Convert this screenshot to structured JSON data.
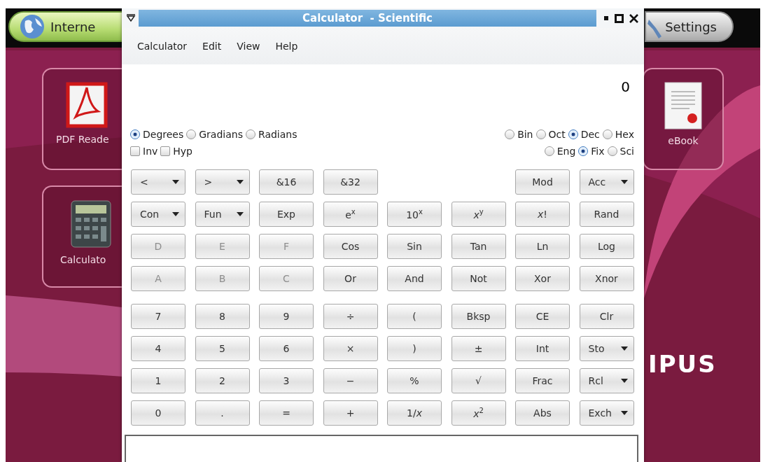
{
  "desktop": {
    "top_bar": [
      {
        "label": "Interne",
        "kind": "internet"
      },
      {
        "label": "Settings",
        "kind": "settings"
      }
    ],
    "tiles": [
      {
        "label": "PDF Reade",
        "kind": "pdf"
      },
      {
        "label": "Calculato",
        "kind": "calculator"
      },
      {
        "label": "eBook",
        "kind": "ebook"
      }
    ],
    "logo": "IPUS"
  },
  "window": {
    "title": "Calculator  - Scientific",
    "menu": [
      "Calculator",
      "Edit",
      "View",
      "Help"
    ],
    "display": "0",
    "angle_modes": [
      {
        "label": "Degrees",
        "selected": true
      },
      {
        "label": "Gradians",
        "selected": false
      },
      {
        "label": "Radians",
        "selected": false
      }
    ],
    "bases": [
      {
        "label": "Bin",
        "selected": false
      },
      {
        "label": "Oct",
        "selected": false
      },
      {
        "label": "Dec",
        "selected": true
      },
      {
        "label": "Hex",
        "selected": false
      }
    ],
    "options": [
      {
        "label": "Inv",
        "checked": false
      },
      {
        "label": "Hyp",
        "checked": false
      }
    ],
    "notations": [
      {
        "label": "Eng",
        "selected": false
      },
      {
        "label": "Fix",
        "selected": true
      },
      {
        "label": "Sci",
        "selected": false
      }
    ],
    "function_rows": [
      {
        "buttons": [
          {
            "label": "<",
            "kind": "dropdown",
            "disabled": false
          },
          {
            "label": ">",
            "kind": "dropdown",
            "disabled": false
          },
          {
            "label": "&16",
            "kind": "plain",
            "disabled": false
          },
          {
            "label": "&32",
            "kind": "plain",
            "disabled": false
          }
        ],
        "end_buttons": [
          {
            "label": "Mod",
            "kind": "plain",
            "disabled": false
          },
          {
            "label": "Acc",
            "kind": "dropdown",
            "disabled": false
          }
        ]
      },
      {
        "buttons": [
          {
            "label": "Con",
            "kind": "dropdown",
            "disabled": false
          },
          {
            "label": "Fun",
            "kind": "dropdown",
            "disabled": false
          },
          {
            "label": "Exp",
            "kind": "plain",
            "disabled": false
          },
          {
            "label": "e$^{x}$",
            "kind": "plain",
            "disabled": false
          },
          {
            "label": "10$^{x}$",
            "kind": "plain",
            "disabled": false
          },
          {
            "label": "*x*$^{y}$",
            "kind": "plain",
            "disabled": false
          },
          {
            "label": "*x*!",
            "kind": "plain",
            "disabled": false
          },
          {
            "label": "Rand",
            "kind": "plain",
            "disabled": false
          }
        ]
      },
      {
        "buttons": [
          {
            "label": "D",
            "kind": "plain",
            "disabled": true
          },
          {
            "label": "E",
            "kind": "plain",
            "disabled": true
          },
          {
            "label": "F",
            "kind": "plain",
            "disabled": true
          },
          {
            "label": "Cos",
            "kind": "plain",
            "disabled": false
          },
          {
            "label": "Sin",
            "kind": "plain",
            "disabled": false
          },
          {
            "label": "Tan",
            "kind": "plain",
            "disabled": false
          },
          {
            "label": "Ln",
            "kind": "plain",
            "disabled": false
          },
          {
            "label": "Log",
            "kind": "plain",
            "disabled": false
          }
        ]
      },
      {
        "buttons": [
          {
            "label": "A",
            "kind": "plain",
            "disabled": true
          },
          {
            "label": "B",
            "kind": "plain",
            "disabled": true
          },
          {
            "label": "C",
            "kind": "plain",
            "disabled": true
          },
          {
            "label": "Or",
            "kind": "plain",
            "disabled": false
          },
          {
            "label": "And",
            "kind": "plain",
            "disabled": false
          },
          {
            "label": "Not",
            "kind": "plain",
            "disabled": false
          },
          {
            "label": "Xor",
            "kind": "plain",
            "disabled": false
          },
          {
            "label": "Xnor",
            "kind": "plain",
            "disabled": false
          }
        ]
      }
    ],
    "number_rows": [
      {
        "buttons": [
          {
            "label": "7",
            "kind": "plain",
            "disabled": false
          },
          {
            "label": "8",
            "kind": "plain",
            "disabled": false
          },
          {
            "label": "9",
            "kind": "plain",
            "disabled": false
          },
          {
            "label": "÷",
            "kind": "plain",
            "disabled": false
          },
          {
            "label": "(",
            "kind": "plain",
            "disabled": false
          },
          {
            "label": "Bksp",
            "kind": "plain",
            "disabled": false
          },
          {
            "label": "CE",
            "kind": "plain",
            "disabled": false
          },
          {
            "label": "Clr",
            "kind": "plain",
            "disabled": false
          }
        ]
      },
      {
        "buttons": [
          {
            "label": "4",
            "kind": "plain",
            "disabled": false
          },
          {
            "label": "5",
            "kind": "plain",
            "disabled": false
          },
          {
            "label": "6",
            "kind": "plain",
            "disabled": false
          },
          {
            "label": "×",
            "kind": "plain",
            "disabled": false
          },
          {
            "label": ")",
            "kind": "plain",
            "disabled": false
          },
          {
            "label": "±",
            "kind": "plain",
            "disabled": false
          },
          {
            "label": "Int",
            "kind": "plain",
            "disabled": false
          },
          {
            "label": "Sto",
            "kind": "dropdown",
            "disabled": false
          }
        ]
      },
      {
        "buttons": [
          {
            "label": "1",
            "kind": "plain",
            "disabled": false
          },
          {
            "label": "2",
            "kind": "plain",
            "disabled": false
          },
          {
            "label": "3",
            "kind": "plain",
            "disabled": false
          },
          {
            "label": "−",
            "kind": "plain",
            "disabled": false
          },
          {
            "label": "%",
            "kind": "plain",
            "disabled": false
          },
          {
            "label": "√",
            "kind": "plain",
            "disabled": false
          },
          {
            "label": "Frac",
            "kind": "plain",
            "disabled": false
          },
          {
            "label": "Rcl",
            "kind": "dropdown",
            "disabled": false
          }
        ]
      },
      {
        "buttons": [
          {
            "label": "0",
            "kind": "plain",
            "disabled": false
          },
          {
            "label": ".",
            "kind": "plain",
            "disabled": false
          },
          {
            "label": "=",
            "kind": "plain",
            "disabled": false
          },
          {
            "label": "+",
            "kind": "plain",
            "disabled": false
          },
          {
            "label": "1/*x*",
            "kind": "plain",
            "disabled": false
          },
          {
            "label": "*x*$^{2}$",
            "kind": "plain",
            "disabled": false
          },
          {
            "label": "Abs",
            "kind": "plain",
            "disabled": false
          },
          {
            "label": "Exch",
            "kind": "dropdown",
            "disabled": false
          }
        ]
      }
    ]
  }
}
